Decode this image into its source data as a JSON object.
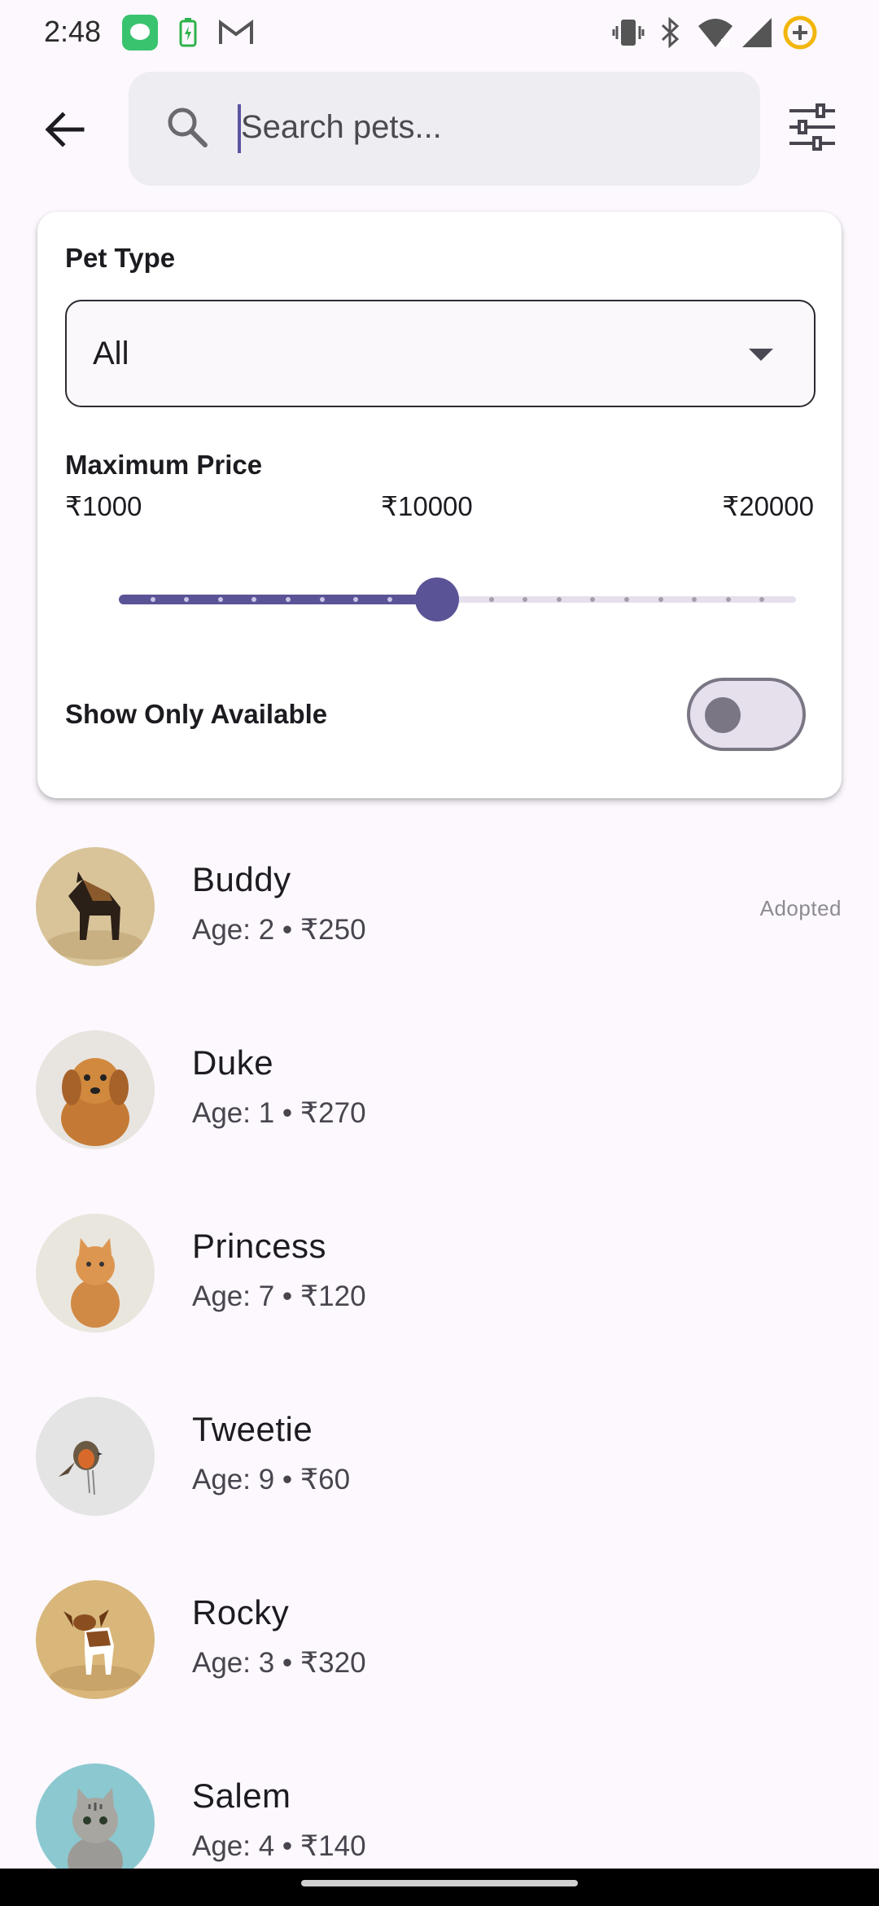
{
  "status_bar": {
    "time": "2:48"
  },
  "search": {
    "placeholder": "Search pets..."
  },
  "filters": {
    "pet_type_label": "Pet Type",
    "pet_type_value": "All",
    "max_price_label": "Maximum Price",
    "price_min": "₹1000",
    "price_mid": "₹10000",
    "price_max": "₹20000",
    "slider_value_fraction": 0.47,
    "slider_steps": 20,
    "available_label": "Show Only Available",
    "available_toggle_on": false
  },
  "pets": [
    {
      "name": "Buddy",
      "meta": "Age: 2 • ₹250",
      "status": "Adopted",
      "image": "german-shepherd"
    },
    {
      "name": "Duke",
      "meta": "Age: 1 • ₹270",
      "status": "",
      "image": "golden-puppy"
    },
    {
      "name": "Princess",
      "meta": "Age: 7 • ₹120",
      "status": "",
      "image": "orange-kitten"
    },
    {
      "name": "Tweetie",
      "meta": "Age: 9 • ₹60",
      "status": "",
      "image": "robin-bird"
    },
    {
      "name": "Rocky",
      "meta": "Age: 3 • ₹320",
      "status": "",
      "image": "beagle"
    },
    {
      "name": "Salem",
      "meta": "Age: 4 • ₹140",
      "status": "",
      "image": "tabby-kitten"
    }
  ],
  "colors": {
    "accent": "#5A5496",
    "background": "#FCF8FE"
  }
}
